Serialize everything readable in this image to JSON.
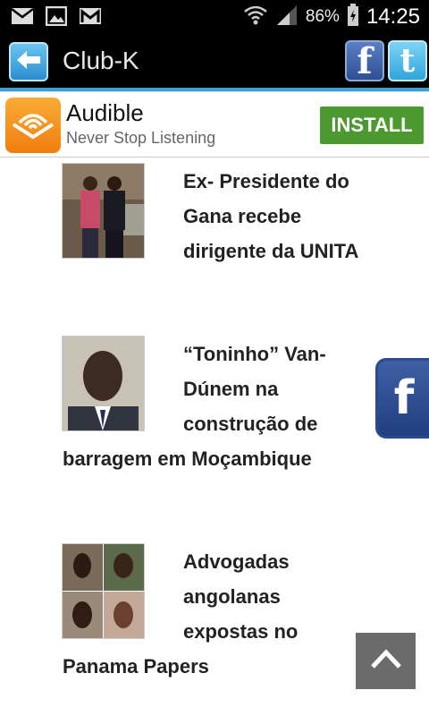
{
  "status_bar": {
    "battery": "86%",
    "time": "14:25",
    "icons": [
      "email-icon",
      "image-icon",
      "gmail-icon",
      "wifi-icon",
      "signal-icon",
      "battery-icon"
    ]
  },
  "app_bar": {
    "title": "Club-K",
    "back_icon": "back-arrow-icon",
    "facebook_letter": "f",
    "twitter_letter": "t",
    "accent": "#3aa0d6"
  },
  "ad": {
    "title": "Audible",
    "subtitle": "Never Stop Listening",
    "button": "INSTALL",
    "button_color": "#4c9a2f"
  },
  "articles": [
    {
      "headline": "Ex- Presidente do Gana recebe dirigente da UNITA",
      "thumb": "two-men-photo"
    },
    {
      "headline": "“Toninho” Van-Dúnem na construção de barragem em Moçambique",
      "thumb": "man-portrait-photo"
    },
    {
      "headline": "Advogadas angolanas expostas no Panama Papers",
      "thumb": "women-collage-photo"
    }
  ],
  "floating": {
    "facebook_letter": "f",
    "scroll_top_icon": "chevron-up-icon"
  }
}
